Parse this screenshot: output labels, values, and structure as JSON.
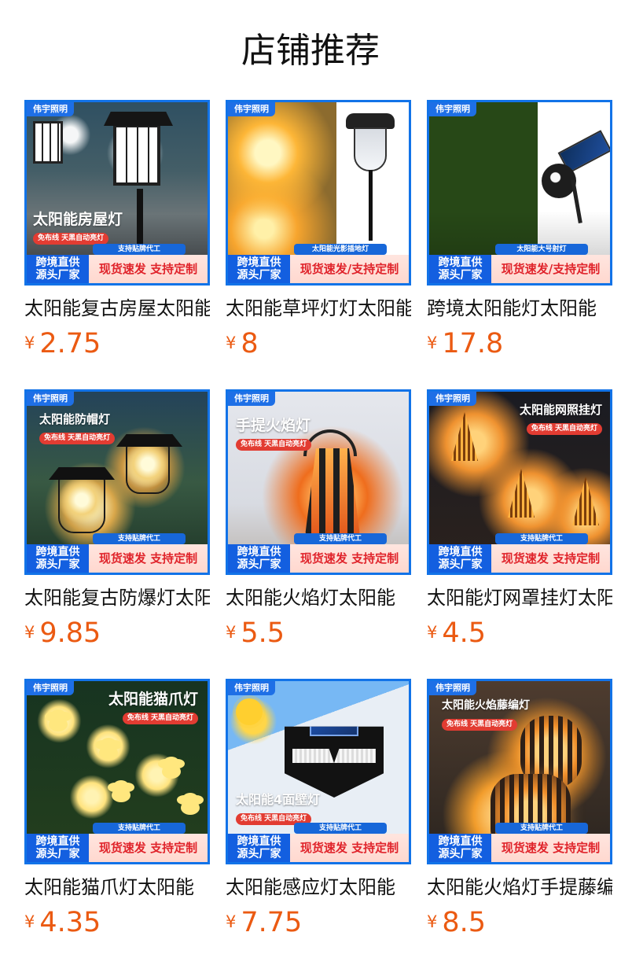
{
  "header": {
    "title": "店铺推荐"
  },
  "products": [
    {
      "name": "太阳能复古房屋太阳能",
      "price": "2.75",
      "currency": "¥",
      "image": {
        "brand": "伟宇照明",
        "headline": "太阳能房屋灯",
        "subline": "免布线 天黑自动亮灯",
        "caption": "支持贴牌代工",
        "left_badge": [
          "跨境直供",
          "源头厂家"
        ],
        "right_badge": "现货速发 支持定制"
      }
    },
    {
      "name": "太阳能草坪灯灯太阳能",
      "price": "8",
      "currency": "¥",
      "image": {
        "brand": "伟宇照明",
        "headline": "",
        "subline": "",
        "caption": "太阳能光影插地灯",
        "left_badge": [
          "跨境直供",
          "源头厂家"
        ],
        "right_badge": "现货速发/支持定制"
      }
    },
    {
      "name": "跨境太阳能灯太阳能",
      "price": "17.8",
      "currency": "¥",
      "image": {
        "brand": "伟宇照明",
        "headline": "",
        "subline": "",
        "caption": "太阳能大号射灯",
        "left_badge": [
          "跨境直供",
          "源头厂家"
        ],
        "right_badge": "现货速发/支持定制"
      }
    },
    {
      "name": "太阳能复古防爆灯太阳",
      "price": "9.85",
      "currency": "¥",
      "image": {
        "brand": "伟宇照明",
        "headline": "太阳能防帽灯",
        "subline": "免布线 天黑自动亮灯",
        "caption": "支持贴牌代工",
        "left_badge": [
          "跨境直供",
          "源头厂家"
        ],
        "right_badge": "现货速发 支持定制"
      }
    },
    {
      "name": "太阳能火焰灯太阳能",
      "price": "5.5",
      "currency": "¥",
      "image": {
        "brand": "伟宇照明",
        "headline": "手提火焰灯",
        "subline": "免布线 天黑自动亮灯",
        "caption": "支持贴牌代工",
        "left_badge": [
          "跨境直供",
          "源头厂家"
        ],
        "right_badge": "现货速发 支持定制"
      }
    },
    {
      "name": "太阳能灯网罩挂灯太阳",
      "price": "4.5",
      "currency": "¥",
      "image": {
        "brand": "伟宇照明",
        "headline": "太阳能网照挂灯",
        "subline": "免布线 天黑自动亮灯",
        "caption": "支持贴牌代工",
        "left_badge": [
          "跨境直供",
          "源头厂家"
        ],
        "right_badge": "现货速发 支持定制"
      }
    },
    {
      "name": "太阳能猫爪灯太阳能",
      "price": "4.35",
      "currency": "¥",
      "image": {
        "brand": "伟宇照明",
        "headline": "太阳能猫爪灯",
        "subline": "免布线 天黑自动亮灯",
        "caption": "支持贴牌代工",
        "left_badge": [
          "跨境直供",
          "源头厂家"
        ],
        "right_badge": "现货速发 支持定制"
      }
    },
    {
      "name": "太阳能感应灯太阳能",
      "price": "7.75",
      "currency": "¥",
      "image": {
        "brand": "伟宇照明",
        "headline": "太阳能4面壁灯",
        "subline": "免布线 天黑自动亮灯",
        "caption": "支持贴牌代工",
        "left_badge": [
          "跨境直供",
          "源头厂家"
        ],
        "right_badge": "现货速发 支持定制"
      }
    },
    {
      "name": "太阳能火焰灯手提藤编",
      "price": "8.5",
      "currency": "¥",
      "image": {
        "brand": "伟宇照明",
        "headline": "太阳能火焰藤编灯",
        "subline": "免布线 天黑自动亮灯",
        "caption": "支持贴牌代工",
        "left_badge": [
          "跨境直供",
          "源头厂家"
        ],
        "right_badge": "现货速发 支持定制"
      }
    }
  ]
}
